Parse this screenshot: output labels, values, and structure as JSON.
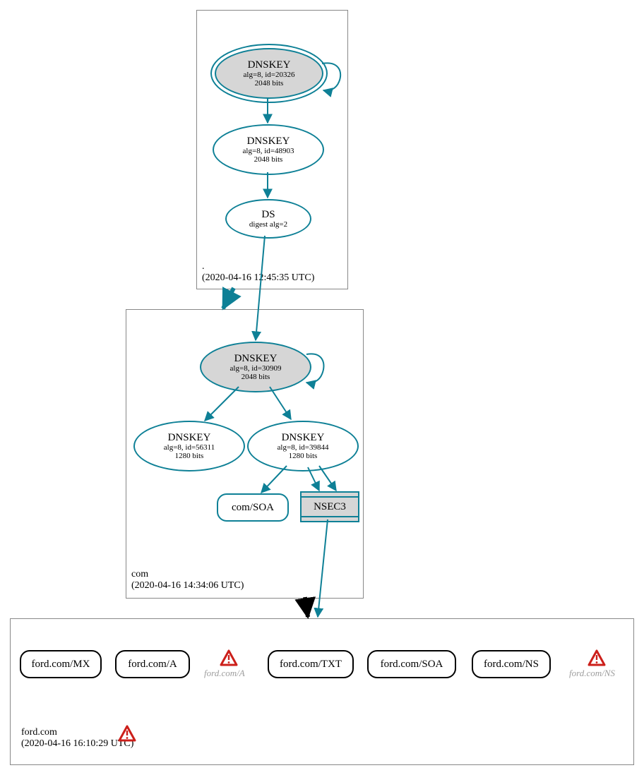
{
  "zones": {
    "root": {
      "name": ".",
      "timestamp": "(2020-04-16 12:45:35 UTC)"
    },
    "com": {
      "name": "com",
      "timestamp": "(2020-04-16 14:34:06 UTC)"
    },
    "ford": {
      "name": "ford.com",
      "timestamp": "(2020-04-16 16:10:29 UTC)"
    }
  },
  "nodes": {
    "root_ksk": {
      "title": "DNSKEY",
      "sub1": "alg=8, id=20326",
      "sub2": "2048 bits"
    },
    "root_zsk": {
      "title": "DNSKEY",
      "sub1": "alg=8, id=48903",
      "sub2": "2048 bits"
    },
    "root_ds": {
      "title": "DS",
      "sub1": "digest alg=2"
    },
    "com_ksk": {
      "title": "DNSKEY",
      "sub1": "alg=8, id=30909",
      "sub2": "2048 bits"
    },
    "com_zsk_a": {
      "title": "DNSKEY",
      "sub1": "alg=8, id=56311",
      "sub2": "1280 bits"
    },
    "com_zsk_b": {
      "title": "DNSKEY",
      "sub1": "alg=8, id=39844",
      "sub2": "1280 bits"
    },
    "com_soa": {
      "label": "com/SOA"
    },
    "nsec3": {
      "label": "NSEC3"
    },
    "ford_mx": {
      "label": "ford.com/MX"
    },
    "ford_a": {
      "label": "ford.com/A"
    },
    "ford_txt": {
      "label": "ford.com/TXT"
    },
    "ford_soa": {
      "label": "ford.com/SOA"
    },
    "ford_ns": {
      "label": "ford.com/NS"
    }
  },
  "warnings": {
    "ford_a_dup": "ford.com/A",
    "ford_ns_dup": "ford.com/NS"
  },
  "chart_data": {
    "type": "graph",
    "description": "DNSSEC authentication chain diagram for ford.com, generated by DNSViz",
    "zones": [
      {
        "name": ".",
        "timestamp": "2020-04-16 12:45:35 UTC"
      },
      {
        "name": "com",
        "timestamp": "2020-04-16 14:34:06 UTC"
      },
      {
        "name": "ford.com",
        "timestamp": "2020-04-16 16:10:29 UTC",
        "has_warnings": true
      }
    ],
    "nodes": [
      {
        "id": "root_ksk",
        "zone": ".",
        "type": "DNSKEY",
        "alg": 8,
        "key_id": 20326,
        "bits": 2048,
        "role": "KSK",
        "trust_anchor": true
      },
      {
        "id": "root_zsk",
        "zone": ".",
        "type": "DNSKEY",
        "alg": 8,
        "key_id": 48903,
        "bits": 2048,
        "role": "ZSK"
      },
      {
        "id": "root_ds",
        "zone": ".",
        "type": "DS",
        "digest_alg": 2
      },
      {
        "id": "com_ksk",
        "zone": "com",
        "type": "DNSKEY",
        "alg": 8,
        "key_id": 30909,
        "bits": 2048,
        "role": "KSK"
      },
      {
        "id": "com_zsk_a",
        "zone": "com",
        "type": "DNSKEY",
        "alg": 8,
        "key_id": 56311,
        "bits": 1280,
        "role": "ZSK"
      },
      {
        "id": "com_zsk_b",
        "zone": "com",
        "type": "DNSKEY",
        "alg": 8,
        "key_id": 39844,
        "bits": 1280,
        "role": "ZSK"
      },
      {
        "id": "com_soa",
        "zone": "com",
        "type": "RRset",
        "name": "com/SOA"
      },
      {
        "id": "nsec3",
        "zone": "com",
        "type": "NSEC3"
      },
      {
        "id": "ford_mx",
        "zone": "ford.com",
        "type": "RRset",
        "name": "ford.com/MX"
      },
      {
        "id": "ford_a",
        "zone": "ford.com",
        "type": "RRset",
        "name": "ford.com/A"
      },
      {
        "id": "ford_a_warn",
        "zone": "ford.com",
        "type": "RRset",
        "name": "ford.com/A",
        "status": "warning"
      },
      {
        "id": "ford_txt",
        "zone": "ford.com",
        "type": "RRset",
        "name": "ford.com/TXT"
      },
      {
        "id": "ford_soa",
        "zone": "ford.com",
        "type": "RRset",
        "name": "ford.com/SOA"
      },
      {
        "id": "ford_ns",
        "zone": "ford.com",
        "type": "RRset",
        "name": "ford.com/NS"
      },
      {
        "id": "ford_ns_warn",
        "zone": "ford.com",
        "type": "RRset",
        "name": "ford.com/NS",
        "status": "warning"
      }
    ],
    "edges": [
      {
        "from": "root_ksk",
        "to": "root_ksk",
        "kind": "self-sign"
      },
      {
        "from": "root_ksk",
        "to": "root_zsk",
        "kind": "signs"
      },
      {
        "from": "root_zsk",
        "to": "root_ds",
        "kind": "signs"
      },
      {
        "from": "root_ds",
        "to": "com_ksk",
        "kind": "delegation"
      },
      {
        "from": ".",
        "to": "com",
        "kind": "zone-delegation"
      },
      {
        "from": "com_ksk",
        "to": "com_ksk",
        "kind": "self-sign"
      },
      {
        "from": "com_ksk",
        "to": "com_zsk_a",
        "kind": "signs"
      },
      {
        "from": "com_ksk",
        "to": "com_zsk_b",
        "kind": "signs"
      },
      {
        "from": "com_zsk_b",
        "to": "com_soa",
        "kind": "signs"
      },
      {
        "from": "com_zsk_b",
        "to": "nsec3",
        "kind": "signs"
      },
      {
        "from": "com",
        "to": "ford.com",
        "kind": "zone-delegation"
      },
      {
        "from": "nsec3",
        "to": "ford.com",
        "kind": "nsec3-proof"
      }
    ]
  }
}
